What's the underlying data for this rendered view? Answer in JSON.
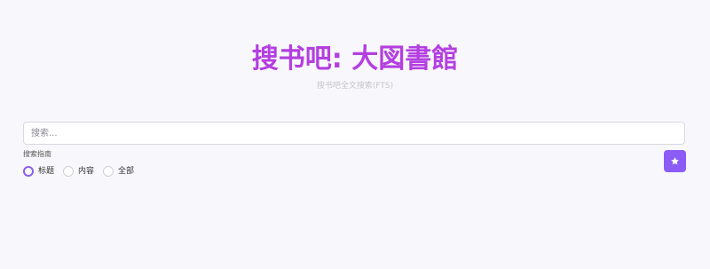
{
  "header": {
    "title": "搜书吧: 大図書館",
    "subtitle": "搜书吧全文搜索(FTS)"
  },
  "search": {
    "placeholder": "搜索...",
    "value": ""
  },
  "guide": {
    "label": "搜索指南"
  },
  "scope": {
    "options": [
      {
        "label": "标题",
        "checked": true
      },
      {
        "label": "内容",
        "checked": false
      },
      {
        "label": "全部",
        "checked": false
      }
    ]
  },
  "favorite_button": {
    "icon": "star-icon",
    "color": "#8b5cf6"
  },
  "colors": {
    "title": "#b43fe0",
    "accent": "#8b5cf6",
    "background": "#f8f8fc"
  }
}
